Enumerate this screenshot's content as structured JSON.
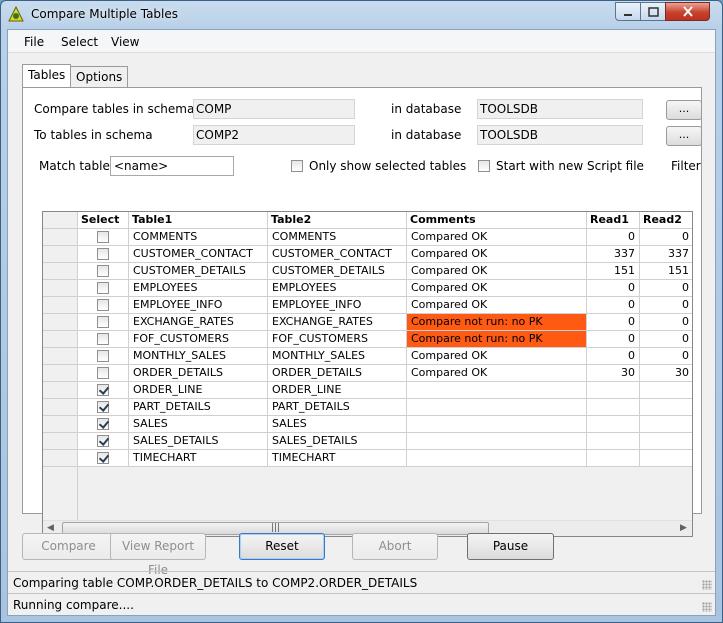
{
  "window": {
    "title": "Compare Multiple Tables"
  },
  "menu": [
    "File",
    "Select",
    "View"
  ],
  "tabs": [
    {
      "label": "Tables",
      "active": true
    },
    {
      "label": "Options",
      "active": false
    }
  ],
  "form": {
    "compare_label": "Compare tables in schema",
    "compare_schema": "COMP",
    "in_database_label": "in database",
    "compare_db": "TOOLSDB",
    "to_label": "To tables in schema",
    "to_schema": "COMP2",
    "to_db": "TOOLSDB",
    "browse_label": "...",
    "match_label": "Match tables",
    "match_value": "<name>",
    "only_selected_label": "Only show selected tables",
    "only_selected_checked": false,
    "start_script_label": "Start with new Script file",
    "start_script_checked": false,
    "filter_label": "Filter"
  },
  "grid": {
    "columns": [
      "",
      "Select",
      "Table1",
      "Table2",
      "Comments",
      "Read1",
      "Read2"
    ],
    "rows": [
      {
        "selected": false,
        "table1": "COMMENTS",
        "table2": "COMMENTS",
        "comment": "Compared OK",
        "error": false,
        "read1": "0",
        "read2": "0"
      },
      {
        "selected": false,
        "table1": "CUSTOMER_CONTACT",
        "table2": "CUSTOMER_CONTACT",
        "comment": "Compared OK",
        "error": false,
        "read1": "337",
        "read2": "337"
      },
      {
        "selected": false,
        "table1": "CUSTOMER_DETAILS",
        "table2": "CUSTOMER_DETAILS",
        "comment": "Compared OK",
        "error": false,
        "read1": "151",
        "read2": "151"
      },
      {
        "selected": false,
        "table1": "EMPLOYEES",
        "table2": "EMPLOYEES",
        "comment": "Compared OK",
        "error": false,
        "read1": "0",
        "read2": "0"
      },
      {
        "selected": false,
        "table1": "EMPLOYEE_INFO",
        "table2": "EMPLOYEE_INFO",
        "comment": "Compared OK",
        "error": false,
        "read1": "0",
        "read2": "0"
      },
      {
        "selected": false,
        "table1": "EXCHANGE_RATES",
        "table2": "EXCHANGE_RATES",
        "comment": "Compare not run: no PK",
        "error": true,
        "read1": "0",
        "read2": "0"
      },
      {
        "selected": false,
        "table1": "FOF_CUSTOMERS",
        "table2": "FOF_CUSTOMERS",
        "comment": "Compare not run: no PK",
        "error": true,
        "read1": "0",
        "read2": "0"
      },
      {
        "selected": false,
        "table1": "MONTHLY_SALES",
        "table2": "MONTHLY_SALES",
        "comment": "Compared OK",
        "error": false,
        "read1": "0",
        "read2": "0"
      },
      {
        "selected": false,
        "table1": "ORDER_DETAILS",
        "table2": "ORDER_DETAILS",
        "comment": "Compared OK",
        "error": false,
        "read1": "30",
        "read2": "30"
      },
      {
        "selected": true,
        "table1": "ORDER_LINE",
        "table2": "ORDER_LINE",
        "comment": "",
        "error": false,
        "read1": "",
        "read2": ""
      },
      {
        "selected": true,
        "table1": "PART_DETAILS",
        "table2": "PART_DETAILS",
        "comment": "",
        "error": false,
        "read1": "",
        "read2": ""
      },
      {
        "selected": true,
        "table1": "SALES",
        "table2": "SALES",
        "comment": "",
        "error": false,
        "read1": "",
        "read2": ""
      },
      {
        "selected": true,
        "table1": "SALES_DETAILS",
        "table2": "SALES_DETAILS",
        "comment": "",
        "error": false,
        "read1": "",
        "read2": ""
      },
      {
        "selected": true,
        "table1": "TIMECHART",
        "table2": "TIMECHART",
        "comment": "",
        "error": false,
        "read1": "",
        "read2": ""
      }
    ],
    "scroll_thumb_grip": "|||",
    "colors": {
      "error_bg": "#ff5a14"
    }
  },
  "buttons": {
    "compare": "Compare",
    "view_report": "View Report File",
    "reset": "Reset",
    "abort": "Abort",
    "pause": "Pause"
  },
  "status": {
    "line1": "Comparing table COMP.ORDER_DETAILS to COMP2.ORDER_DETAILS",
    "line2": "Running compare...."
  }
}
